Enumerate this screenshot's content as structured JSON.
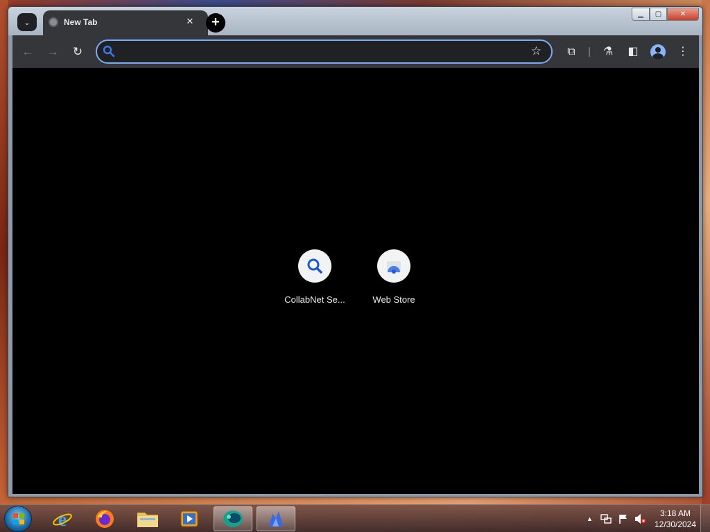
{
  "browser": {
    "tab": {
      "title": "New Tab",
      "close_symbol": "✕"
    },
    "new_tab_symbol": "+",
    "tab_search_symbol": "⌄",
    "window_controls": {
      "minimize": "▁",
      "maximize": "▢",
      "close": "✕"
    },
    "toolbar": {
      "back": "←",
      "forward": "→",
      "reload": "↻",
      "omnibox_value": "",
      "bookmark_star": "☆",
      "extensions": "⧉",
      "labs": "⚗",
      "side_panel": "◧",
      "menu": "⋮"
    },
    "shortcuts": [
      {
        "label": "CollabNet Se...",
        "icon": "search-icon"
      },
      {
        "label": "Web Store",
        "icon": "web-store-icon"
      }
    ],
    "accent_color": "#7cacf8"
  },
  "taskbar": {
    "apps": [
      {
        "name": "internet-explorer",
        "active": false
      },
      {
        "name": "firefox",
        "active": false
      },
      {
        "name": "file-explorer",
        "active": false
      },
      {
        "name": "media-player",
        "active": false
      },
      {
        "name": "chrome-like-browser",
        "active": true
      },
      {
        "name": "blue-app",
        "active": true
      }
    ],
    "tray": {
      "show_hidden": "▲",
      "clock_time": "3:18 AM",
      "clock_date": "12/30/2024"
    }
  }
}
